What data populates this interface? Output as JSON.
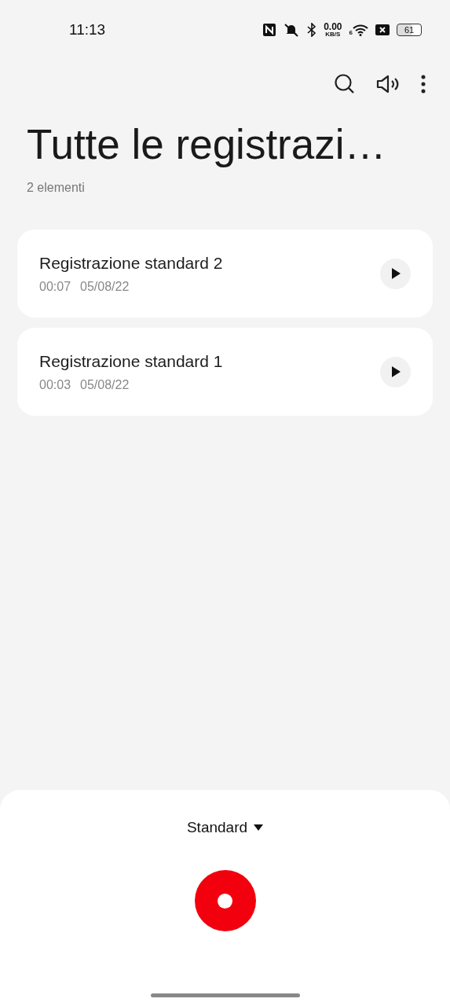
{
  "status_bar": {
    "time": "11:13",
    "speed_value": "0.00",
    "speed_unit": "KB/S",
    "wifi_label": "6",
    "battery": "61"
  },
  "title": "Tutte le registrazi…",
  "subtitle": "2 elementi",
  "recordings": [
    {
      "name": "Registrazione standard 2",
      "duration": "00:07",
      "date": "05/08/22"
    },
    {
      "name": "Registrazione standard 1",
      "duration": "00:03",
      "date": "05/08/22"
    }
  ],
  "mode_selector": {
    "label": "Standard"
  }
}
